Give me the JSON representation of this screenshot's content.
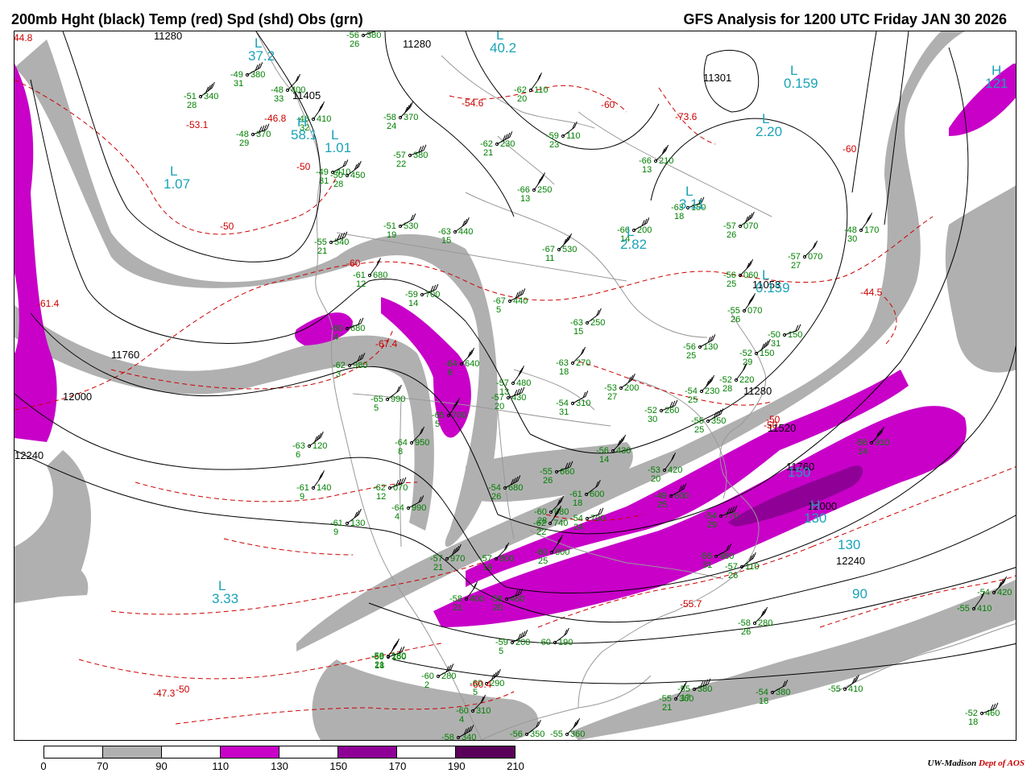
{
  "header": {
    "title_left": "200mb Hght (black) Temp (red) Spd (shd) Obs (grn)",
    "title_right": "GFS Analysis for 1200 UTC Friday  JAN 30 2026"
  },
  "colors": {
    "height_contour": "#000000",
    "temperature_contour": "#cc0000",
    "observation": "#008000",
    "center_label": "#1aa3b8",
    "geography": "#999999",
    "speed_70_90": "#b0b0b0",
    "speed_110_130": "#c800c8",
    "speed_150_170": "#8f0096",
    "speed_190_210": "#5a005a"
  },
  "height_labels": [
    {
      "text": "11280",
      "role": "height-contour-label"
    },
    {
      "text": "11280",
      "role": "height-contour-label"
    },
    {
      "text": "11405",
      "role": "height-contour-label"
    },
    {
      "text": "11301",
      "role": "height-contour-label"
    },
    {
      "text": "11760",
      "role": "height-contour-label"
    },
    {
      "text": "12000",
      "role": "height-contour-label"
    },
    {
      "text": "12240",
      "role": "height-contour-label"
    },
    {
      "text": "11053",
      "role": "height-contour-label"
    },
    {
      "text": "11280",
      "role": "height-contour-label"
    },
    {
      "text": "11520",
      "role": "height-contour-label"
    },
    {
      "text": "11760",
      "role": "height-contour-label"
    },
    {
      "text": "12000",
      "role": "height-contour-label"
    },
    {
      "text": "12240",
      "role": "height-contour-label"
    }
  ],
  "temperature_labels": [
    "-44.8",
    "-53.1",
    "-46.8",
    "-50",
    "-50",
    "-60",
    "-54.6",
    "-60",
    "-73.6",
    "-67.4",
    "-61.4",
    "-60",
    "-44.5",
    "-50",
    "-50",
    "-55.7",
    "-60.4",
    "-47.3",
    "-50"
  ],
  "centers": [
    {
      "letter": "L",
      "value": "37.2"
    },
    {
      "letter": "L",
      "value": "40.2"
    },
    {
      "letter": "L",
      "value": "1.01"
    },
    {
      "letter": "L",
      "value": "1.07"
    },
    {
      "letter": "H",
      "value": "58.1"
    },
    {
      "letter": "L",
      "value": "0.159"
    },
    {
      "letter": "L",
      "value": "2.20"
    },
    {
      "letter": "L",
      "value": "3.11"
    },
    {
      "letter": "L",
      "value": "2.82"
    },
    {
      "letter": "L",
      "value": "0.159"
    },
    {
      "letter": "H",
      "value": "121"
    },
    {
      "letter": "L",
      "value": "3.33"
    },
    {
      "letter": "H",
      "value": "130"
    },
    {
      "letter": "",
      "value": "90"
    },
    {
      "letter": "",
      "value": "150"
    },
    {
      "letter": "",
      "value": "130"
    }
  ],
  "observations": [
    {
      "temp": "-56",
      "dew": "26",
      "hgt": "380"
    },
    {
      "temp": "-49",
      "dew": "31",
      "hgt": "380"
    },
    {
      "temp": "-51",
      "dew": "28",
      "hgt": "340"
    },
    {
      "temp": "-48",
      "dew": "33",
      "hgt": "400"
    },
    {
      "temp": "-46",
      "dew": "32",
      "hgt": "410"
    },
    {
      "temp": "-48",
      "dew": "29",
      "hgt": "370"
    },
    {
      "temp": "-49",
      "dew": "31",
      "hgt": "410"
    },
    {
      "temp": "-50",
      "dew": "28",
      "hgt": "450"
    },
    {
      "temp": "-58",
      "dew": "24",
      "hgt": "370"
    },
    {
      "temp": "-62",
      "dew": "20",
      "hgt": "110"
    },
    {
      "temp": "-57",
      "dew": "22",
      "hgt": "380"
    },
    {
      "temp": "-62",
      "dew": "21",
      "hgt": "230"
    },
    {
      "temp": "-59",
      "dew": "23",
      "hgt": "110"
    },
    {
      "temp": "-66",
      "dew": "13",
      "hgt": "210"
    },
    {
      "temp": "-66",
      "dew": "13",
      "hgt": "250"
    },
    {
      "temp": "-63",
      "dew": "18",
      "hgt": "150"
    },
    {
      "temp": "-66",
      "dew": "14",
      "hgt": "200"
    },
    {
      "temp": "-57",
      "dew": "26",
      "hgt": "070"
    },
    {
      "temp": "-57",
      "dew": "27",
      "hgt": "070"
    },
    {
      "temp": "-48",
      "dew": "30",
      "hgt": "170"
    },
    {
      "temp": "-55",
      "dew": "21",
      "hgt": "540"
    },
    {
      "temp": "-51",
      "dew": "19",
      "hgt": "530"
    },
    {
      "temp": "-63",
      "dew": "15",
      "hgt": "440"
    },
    {
      "temp": "-67",
      "dew": "11",
      "hgt": "530"
    },
    {
      "temp": "-61",
      "dew": "12",
      "hgt": "680"
    },
    {
      "temp": "-59",
      "dew": "14",
      "hgt": "700"
    },
    {
      "temp": "-67",
      "dew": "5",
      "hgt": "440"
    },
    {
      "temp": "-63",
      "dew": "15",
      "hgt": "250"
    },
    {
      "temp": "-56",
      "dew": "25",
      "hgt": "060"
    },
    {
      "temp": "-55",
      "dew": "26",
      "hgt": "070"
    },
    {
      "temp": "-50",
      "dew": "31",
      "hgt": "150"
    },
    {
      "temp": "-56",
      "dew": "25",
      "hgt": "130"
    },
    {
      "temp": "-52",
      "dew": "29",
      "hgt": "150"
    },
    {
      "temp": "-63",
      "dew": "18",
      "hgt": "270"
    },
    {
      "temp": "-57",
      "dew": "13",
      "hgt": "480"
    },
    {
      "temp": "-57",
      "dew": "20",
      "hgt": "430"
    },
    {
      "temp": "-54",
      "dew": "31",
      "hgt": "310"
    },
    {
      "temp": "-53",
      "dew": "27",
      "hgt": "200"
    },
    {
      "temp": "-54",
      "dew": "25",
      "hgt": "230"
    },
    {
      "temp": "-52",
      "dew": "28",
      "hgt": "220"
    },
    {
      "temp": "-52",
      "dew": "30",
      "hgt": "260"
    },
    {
      "temp": "-55",
      "dew": "25",
      "hgt": "350"
    },
    {
      "temp": "-65",
      "dew": "5",
      "hgt": "990"
    },
    {
      "temp": "-64",
      "dew": "6",
      "hgt": "640"
    },
    {
      "temp": "-65",
      "dew": "5",
      "hgt": "700"
    },
    {
      "temp": "-60",
      "dew": "4",
      "hgt": "680"
    },
    {
      "temp": "-62",
      "dew": "3",
      "hgt": "980"
    },
    {
      "temp": "-63",
      "dew": "6",
      "hgt": "120"
    },
    {
      "temp": "-64",
      "dew": "8",
      "hgt": "950"
    },
    {
      "temp": "-61",
      "dew": "9",
      "hgt": "140"
    },
    {
      "temp": "-62",
      "dew": "12",
      "hgt": "070"
    },
    {
      "temp": "-64",
      "dew": "4",
      "hgt": "990"
    },
    {
      "temp": "-61",
      "dew": "9",
      "hgt": "130"
    },
    {
      "temp": "-56",
      "dew": "14",
      "hgt": "430"
    },
    {
      "temp": "-53",
      "dew": "20",
      "hgt": "420"
    },
    {
      "temp": "-55",
      "dew": "26",
      "hgt": "660"
    },
    {
      "temp": "-54",
      "dew": "26",
      "hgt": "680"
    },
    {
      "temp": "-61",
      "dew": "18",
      "hgt": "600"
    },
    {
      "temp": "-60",
      "dew": "28",
      "hgt": "680"
    },
    {
      "temp": "-62",
      "dew": "22",
      "hgt": "740"
    },
    {
      "temp": "-54",
      "dew": "24",
      "hgt": "700"
    },
    {
      "temp": "-49",
      "dew": "25",
      "hgt": "600"
    },
    {
      "temp": "-57",
      "dew": "21",
      "hgt": "970"
    },
    {
      "temp": "-57",
      "dew": "19",
      "hgt": "800"
    },
    {
      "temp": "-60",
      "dew": "25",
      "hgt": "800"
    },
    {
      "temp": "-54",
      "dew": "29",
      "hgt": "770"
    },
    {
      "temp": "-56",
      "dew": "31",
      "hgt": "980"
    },
    {
      "temp": "-57",
      "dew": "26",
      "hgt": "110"
    },
    {
      "temp": "-58",
      "dew": "14",
      "hgt": "910"
    },
    {
      "temp": "-58",
      "dew": "21",
      "hgt": "400"
    },
    {
      "temp": "-58",
      "dew": "20",
      "hgt": "460"
    },
    {
      "temp": "-59",
      "dew": "5",
      "hgt": "200"
    },
    {
      "temp": "-60",
      "dew": "",
      "hgt": "190"
    },
    {
      "temp": "-58",
      "dew": "26",
      "hgt": "280"
    },
    {
      "temp": "-58",
      "dew": "21",
      "hgt": "180"
    },
    {
      "temp": "-59",
      "dew": "18",
      "hgt": "260"
    },
    {
      "temp": "-60",
      "dew": "2",
      "hgt": "280"
    },
    {
      "temp": "-60",
      "dew": "5",
      "hgt": "290"
    },
    {
      "temp": "-60",
      "dew": "4",
      "hgt": "310"
    },
    {
      "temp": "-55",
      "dew": "21",
      "hgt": "360"
    },
    {
      "temp": "-55",
      "dew": "17",
      "hgt": "380"
    },
    {
      "temp": "-54",
      "dew": "18",
      "hgt": "380"
    },
    {
      "temp": "-55",
      "dew": "",
      "hgt": "410"
    },
    {
      "temp": "-54",
      "dew": "",
      "hgt": "420"
    },
    {
      "temp": "-55",
      "dew": "",
      "hgt": "410"
    },
    {
      "temp": "-52",
      "dew": "18",
      "hgt": "460"
    },
    {
      "temp": "-58",
      "dew": "",
      "hgt": "340"
    },
    {
      "temp": "-56",
      "dew": "",
      "hgt": "350"
    },
    {
      "temp": "-55",
      "dew": "",
      "hgt": "360"
    }
  ],
  "legend": {
    "ticks": [
      "0",
      "70",
      "90",
      "110",
      "130",
      "150",
      "170",
      "190",
      "210"
    ],
    "fills": [
      "#ffffff",
      "#b0b0b0",
      "#ffffff",
      "#c800c8",
      "#ffffff",
      "#8f0096",
      "#ffffff",
      "#5a005a"
    ]
  },
  "credit": {
    "org": "UW-Madison",
    "dept": "Dept of AOS"
  }
}
